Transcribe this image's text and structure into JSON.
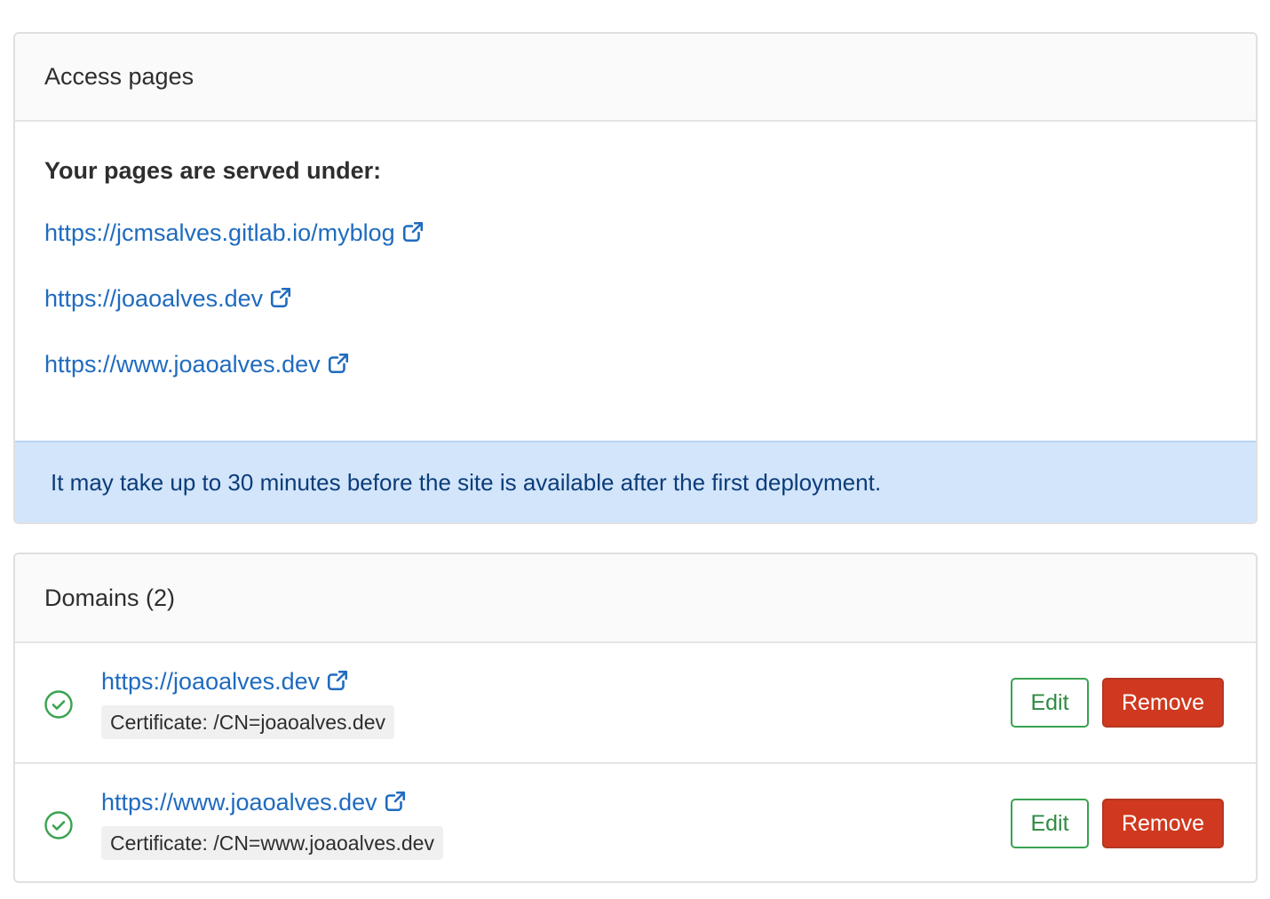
{
  "access": {
    "header": "Access pages",
    "served_title": "Your pages are served under:",
    "links": [
      "https://jcmsalves.gitlab.io/myblog",
      "https://joaoalves.dev",
      "https://www.joaoalves.dev"
    ],
    "alert": "It may take up to 30 minutes before the site is available after the first deployment."
  },
  "domains": {
    "header": "Domains (2)",
    "items": [
      {
        "url": "https://joaoalves.dev",
        "certificate": "Certificate: /CN=joaoalves.dev",
        "edit_label": "Edit",
        "remove_label": "Remove"
      },
      {
        "url": "https://www.joaoalves.dev",
        "certificate": "Certificate: /CN=www.joaoalves.dev",
        "edit_label": "Edit",
        "remove_label": "Remove"
      }
    ]
  },
  "icons": {
    "external_link": "external-link-icon",
    "status": "check-circle-icon"
  },
  "colors": {
    "link": "#1f6bbf",
    "alert_bg": "#d2e5fb",
    "alert_text": "#0b3c78",
    "success": "#39a250",
    "danger": "#d0391f"
  }
}
